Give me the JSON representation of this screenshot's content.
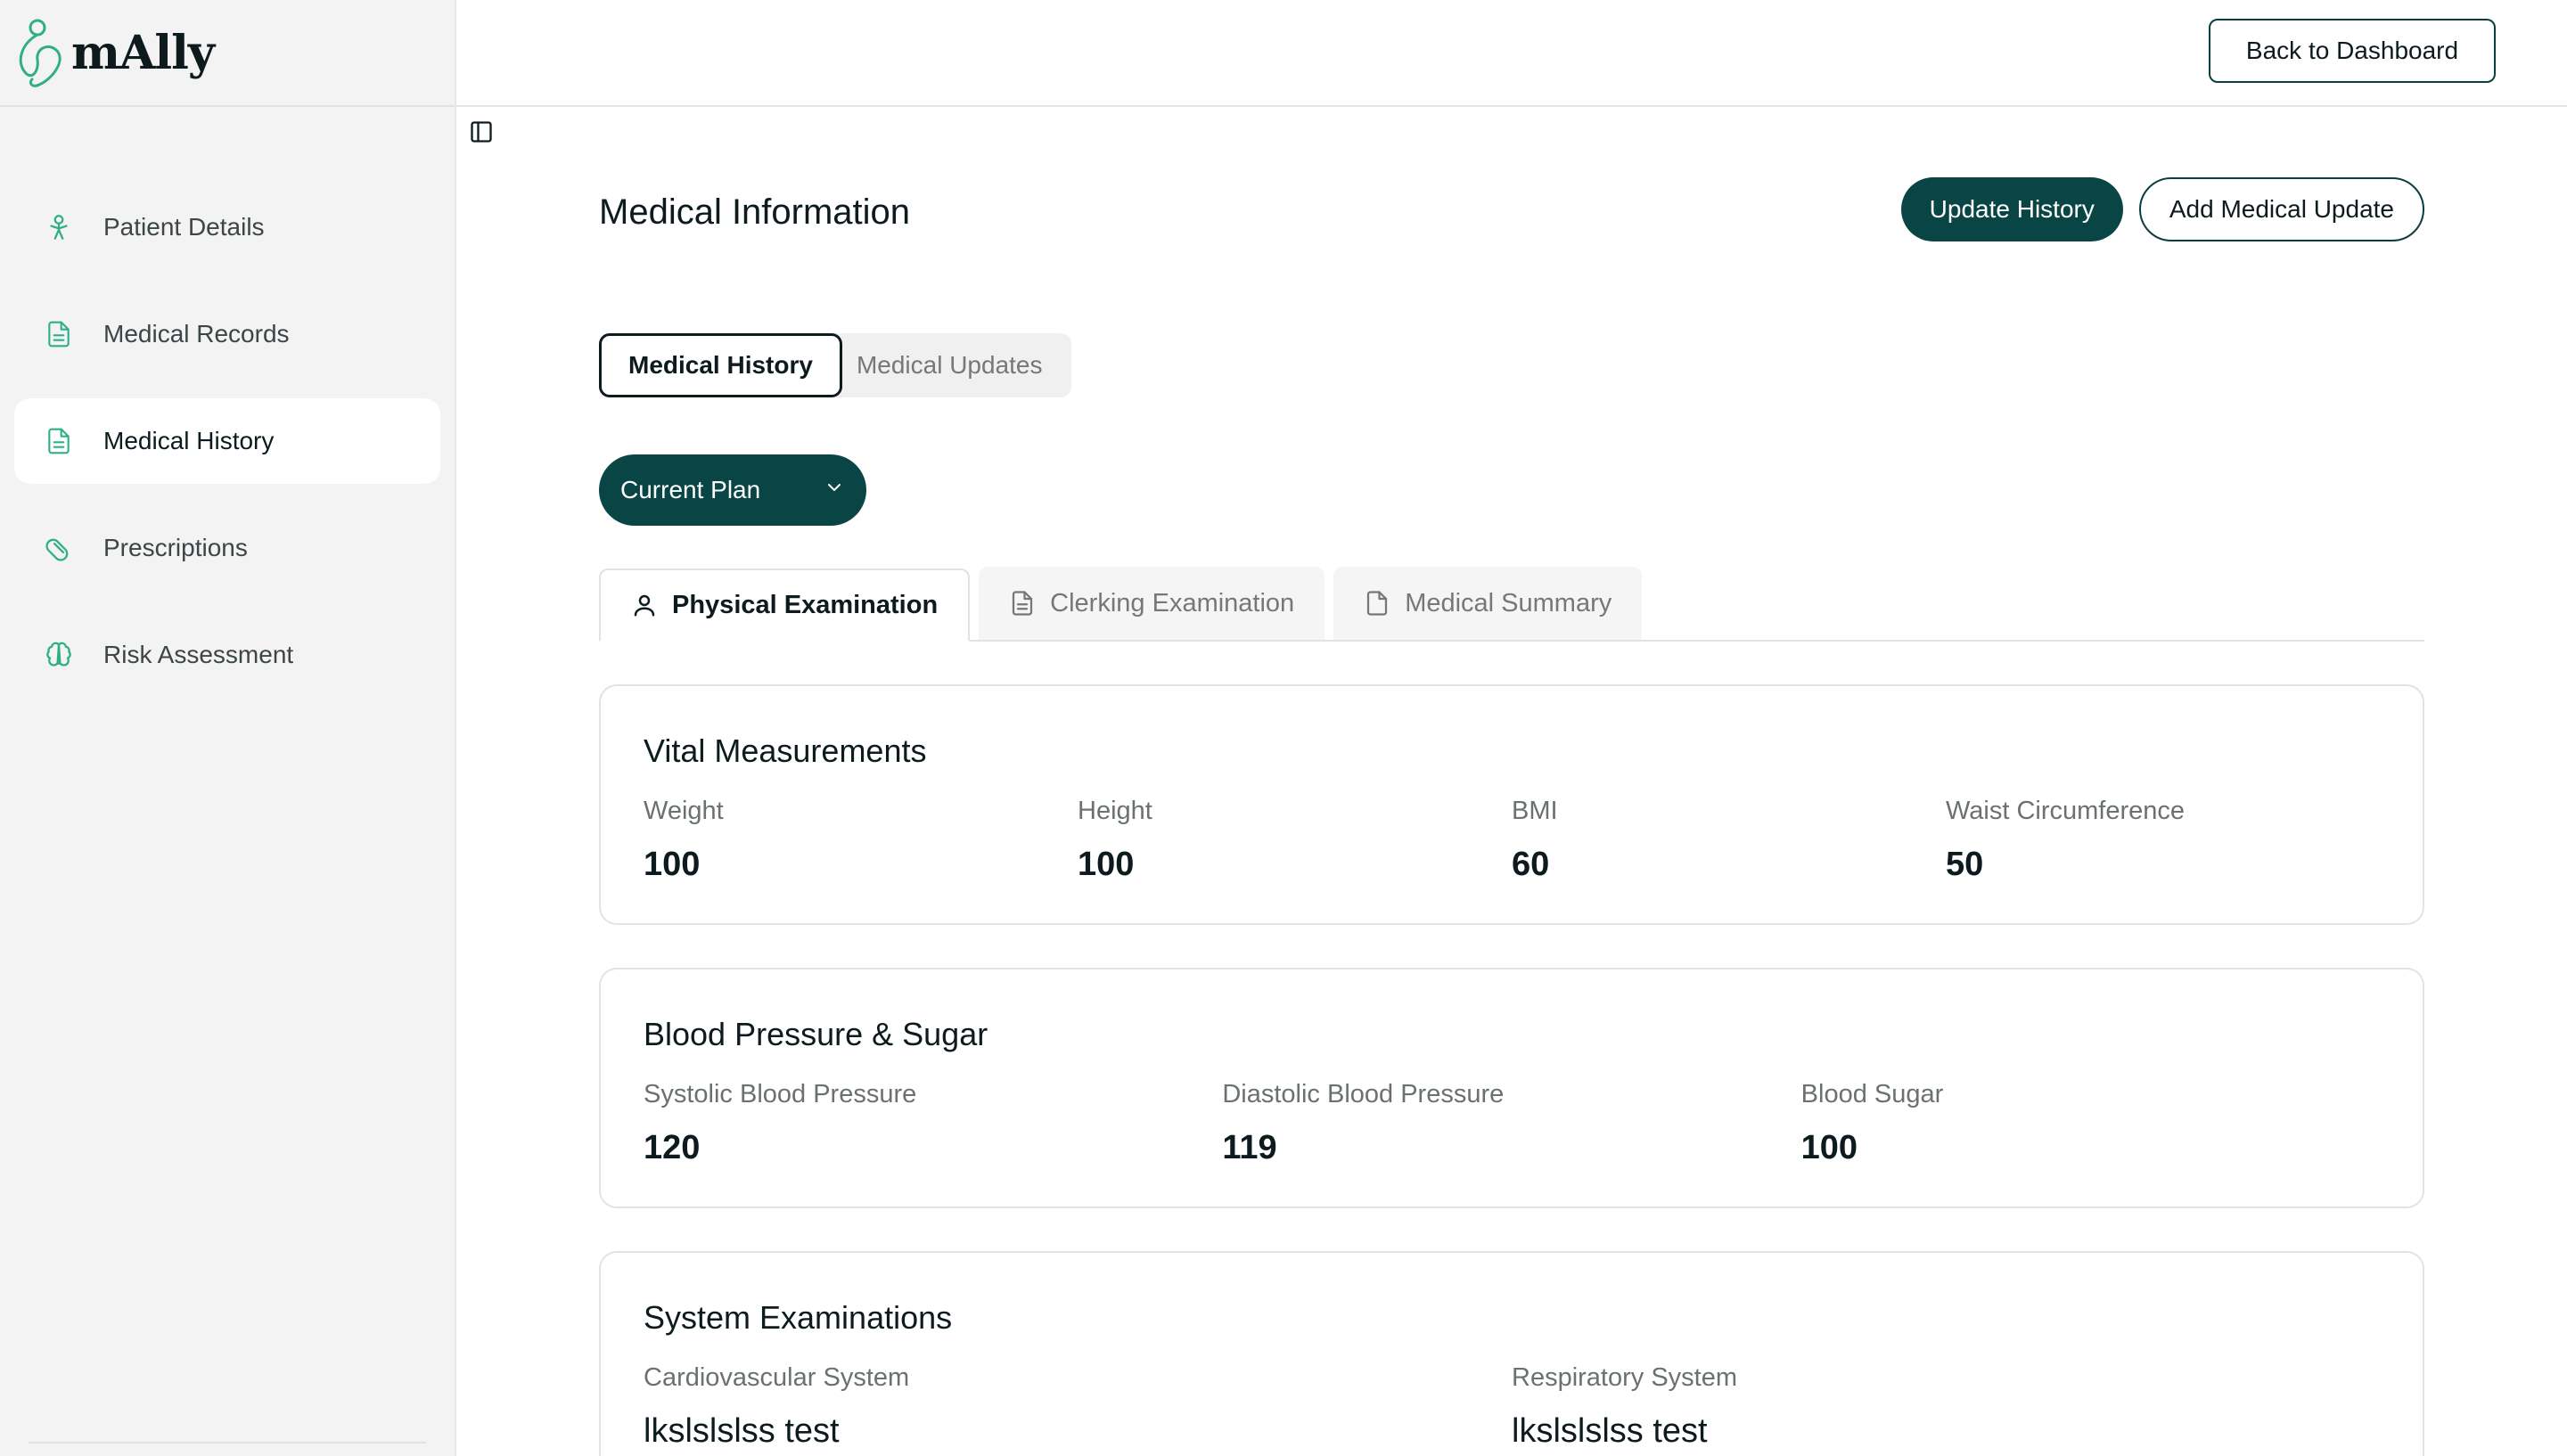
{
  "brand": {
    "name": "mAlly",
    "accent": "#0a4545",
    "icon_accent": "#2fae87"
  },
  "sidebar": {
    "items": [
      {
        "label": "Patient Details",
        "icon": "user-icon",
        "active": false
      },
      {
        "label": "Medical Records",
        "icon": "file-text-icon",
        "active": false
      },
      {
        "label": "Medical History",
        "icon": "file-text-icon",
        "active": true
      },
      {
        "label": "Prescriptions",
        "icon": "pill-icon",
        "active": false
      },
      {
        "label": "Risk Assessment",
        "icon": "brain-icon",
        "active": false
      }
    ]
  },
  "topbar": {
    "back_label": "Back to Dashboard"
  },
  "page": {
    "title": "Medical Information",
    "update_history_label": "Update History",
    "add_update_label": "Add Medical Update"
  },
  "segment": {
    "history": "Medical History",
    "updates": "Medical Updates"
  },
  "plan_dropdown": {
    "selected": "Current Plan"
  },
  "tabs": [
    {
      "label": "Physical Examination",
      "icon": "user-icon",
      "active": true
    },
    {
      "label": "Clerking Examination",
      "icon": "file-text-icon",
      "active": false
    },
    {
      "label": "Medical Summary",
      "icon": "file-icon",
      "active": false
    }
  ],
  "vitals": {
    "title": "Vital Measurements",
    "fields": [
      {
        "label": "Weight",
        "value": "100"
      },
      {
        "label": "Height",
        "value": "100"
      },
      {
        "label": "BMI",
        "value": "60"
      },
      {
        "label": "Waist Circumference",
        "value": "50"
      }
    ]
  },
  "bp": {
    "title": "Blood Pressure & Sugar",
    "fields": [
      {
        "label": "Systolic Blood Pressure",
        "value": "120"
      },
      {
        "label": "Diastolic Blood Pressure",
        "value": "119"
      },
      {
        "label": "Blood Sugar",
        "value": "100"
      }
    ]
  },
  "systems": {
    "title": "System Examinations",
    "fields": [
      {
        "label": "Cardiovascular System",
        "value": "lkslslslss test"
      },
      {
        "label": "Respiratory System",
        "value": "lkslslslss test"
      }
    ]
  }
}
